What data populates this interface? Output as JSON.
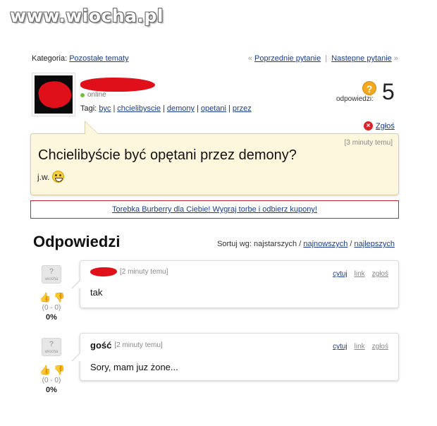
{
  "watermark": "www.wiocha.pl",
  "category": {
    "label": "Kategoria:",
    "value": "Pozostałe tematy"
  },
  "nav": {
    "prev": "Poprzednie pytanie",
    "next": "Nastepne pytanie",
    "left_arrows": "«",
    "right_arrows": "»",
    "sep": "|"
  },
  "user": {
    "status": "online"
  },
  "tags": {
    "label": "Tagi:",
    "items": [
      "byc",
      "chcielibyscie",
      "demony",
      "opetani",
      "przez"
    ]
  },
  "answers": {
    "icon": "?",
    "label": "odpowiedzi:",
    "count": "5"
  },
  "report": {
    "label": "Zgłoś",
    "icon": "close-icon"
  },
  "question": {
    "time": "[3 minuty temu]",
    "title": "Chcielibyście być opętani przez demony?",
    "body": "j.w."
  },
  "promo": "Torebka Burberry dla Ciebie! Wygraj torbe i odbierz kupony!",
  "section": {
    "title": "Odpowiedzi",
    "sort_label": "Sortuj wg: najstarszych /",
    "sort_newest": "najnowszych",
    "sort_sep": "/",
    "sort_best": "najlepszych"
  },
  "answer_list": [
    {
      "author": "",
      "time": "[2 minuty temu]",
      "text": "tak",
      "score": "(0 - 0)",
      "percent": "0%",
      "actions": [
        "cytuj",
        "link",
        "zgłoś"
      ]
    },
    {
      "author": "gość",
      "time": "[2 minuty temu]",
      "text": "Sory, mam juz żone...",
      "score": "(0 - 0)",
      "percent": "0%",
      "actions": [
        "cytuj",
        "link",
        "zgłoś"
      ]
    }
  ],
  "colors": {
    "link": "#1a3d8f",
    "question_bg": "#fcf7dd",
    "promo_border": "#c9262b",
    "report_red": "#d7262b"
  }
}
